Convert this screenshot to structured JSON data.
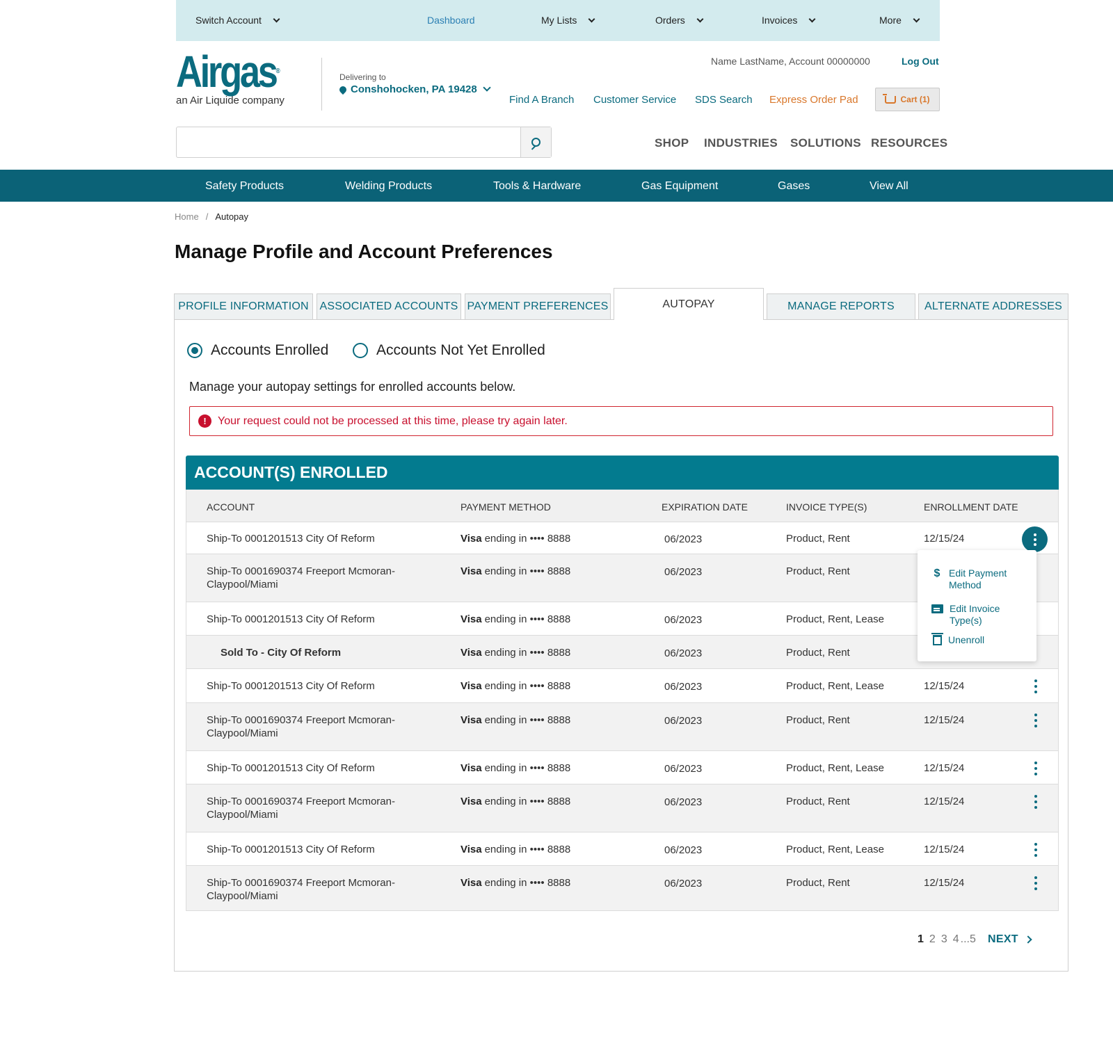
{
  "top_bar": {
    "switch_account": "Switch Account",
    "dashboard": "Dashboard",
    "my_lists": "My Lists",
    "orders": "Orders",
    "invoices": "Invoices",
    "more": "More"
  },
  "brand": {
    "logo_text": "Airgas",
    "tagline": "an Air Liquide company"
  },
  "delivery": {
    "label": "Delivering to",
    "location": "Conshohocken, PA 19428"
  },
  "account": {
    "name": "Name LastName, Account 00000000",
    "logout": "Log Out"
  },
  "header_links": {
    "find_branch": "Find A Branch",
    "customer_service": "Customer Service",
    "sds_search": "SDS Search",
    "express_order_pad": "Express Order Pad",
    "cart": "Cart (1)"
  },
  "search": {
    "placeholder": ""
  },
  "main_nav": {
    "shop": "SHOP",
    "industries": "INDUSTRIES",
    "solutions": "SOLUTIONS",
    "resources": "RESOURCES"
  },
  "category_nav": {
    "safety": "Safety Products",
    "welding": "Welding Products",
    "tools": "Tools & Hardware",
    "gas_equipment": "Gas Equipment",
    "gases": "Gases",
    "view_all": "View All"
  },
  "breadcrumb": {
    "home": "Home",
    "separator": "/",
    "current": "Autopay"
  },
  "page_title": "Manage Profile and Account Preferences",
  "tabs": {
    "profile": "PROFILE INFORMATION",
    "associated": "ASSOCIATED ACCOUNTS",
    "payment": "PAYMENT PREFERENCES",
    "autopay": "AUTOPAY",
    "reports": "MANAGE REPORTS",
    "addresses": "ALTERNATE ADDRESSES"
  },
  "filter": {
    "enrolled": "Accounts Enrolled",
    "not_enrolled": "Accounts Not Yet Enrolled",
    "selected": "enrolled"
  },
  "intro_text": "Manage your autopay settings for enrolled accounts below.",
  "error_message": "Your request could not be processed at this time, please try again later.",
  "table": {
    "title": "ACCOUNT(S) ENROLLED",
    "headers": {
      "account": "ACCOUNT",
      "payment_method": "PAYMENT METHOD",
      "expiration": "EXPIRATION DATE",
      "invoice_types": "INVOICE TYPE(S)",
      "enrollment": "ENROLLMENT DATE"
    },
    "card_brand": "Visa",
    "card_suffix": "ending in •••• 8888",
    "rows": [
      {
        "account": "Ship-To 0001201513 City Of Reform",
        "expiration": "06/2023",
        "invoice_types": "Product, Rent",
        "enrollment": "12/15/24"
      },
      {
        "account": "Ship-To 0001690374 Freeport Mcmoran-Claypool/Miami",
        "expiration": "06/2023",
        "invoice_types": "Product, Rent",
        "enrollment": ""
      },
      {
        "account": "Ship-To 0001201513 City Of Reform",
        "expiration": "06/2023",
        "invoice_types": "Product, Rent, Lease",
        "enrollment": ""
      },
      {
        "account": "Sold To - City Of Reform",
        "expiration": "06/2023",
        "invoice_types": "Product, Rent",
        "enrollment": ""
      },
      {
        "account": "Ship-To 0001201513 City Of Reform",
        "expiration": "06/2023",
        "invoice_types": "Product, Rent, Lease",
        "enrollment": "12/15/24"
      },
      {
        "account": "Ship-To 0001690374 Freeport Mcmoran-Claypool/Miami",
        "expiration": "06/2023",
        "invoice_types": "Product, Rent",
        "enrollment": "12/15/24"
      },
      {
        "account": "Ship-To 0001201513 City Of Reform",
        "expiration": "06/2023",
        "invoice_types": "Product, Rent, Lease",
        "enrollment": "12/15/24"
      },
      {
        "account": "Ship-To 0001690374 Freeport Mcmoran-Claypool/Miami",
        "expiration": "06/2023",
        "invoice_types": "Product, Rent",
        "enrollment": "12/15/24"
      },
      {
        "account": "Ship-To 0001201513 City Of Reform",
        "expiration": "06/2023",
        "invoice_types": "Product, Rent, Lease",
        "enrollment": "12/15/24"
      },
      {
        "account": "Ship-To 0001690374 Freeport Mcmoran-Claypool/Miami",
        "expiration": "06/2023",
        "invoice_types": "Product, Rent",
        "enrollment": "12/15/24"
      }
    ]
  },
  "row_menu": {
    "edit_payment": "Edit Payment Method",
    "edit_invoice": "Edit Invoice Type(s)",
    "unenroll": "Unenroll"
  },
  "pagination": {
    "pages": [
      "1",
      "2",
      "3",
      "4",
      "...5"
    ],
    "current": "1",
    "next": "NEXT"
  },
  "colors": {
    "brand_teal": "#0b6b7f",
    "category_bar": "#0b6277",
    "table_header": "#037b8f",
    "topbar": "#d3ebee",
    "error": "#c8102e",
    "accent_orange": "#d9772b"
  }
}
